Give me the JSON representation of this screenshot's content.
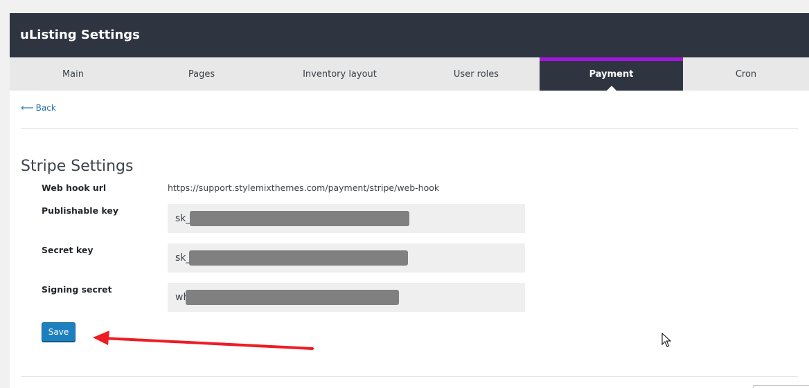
{
  "app": {
    "title": "uListing Settings"
  },
  "tabs": [
    {
      "label": "Main"
    },
    {
      "label": "Pages"
    },
    {
      "label": "Inventory layout"
    },
    {
      "label": "User roles"
    },
    {
      "label": "Payment",
      "active": true
    },
    {
      "label": "Cron"
    }
  ],
  "nav": {
    "back_label": "Back",
    "back_icon": "arrow-left-icon"
  },
  "section": {
    "title": "Stripe Settings"
  },
  "fields": {
    "webhook": {
      "label": "Web hook url",
      "value": "https://support.stylemixthemes.com/payment/stripe/web-hook"
    },
    "publishable": {
      "label": "Publishable key",
      "value": "sk_"
    },
    "secret": {
      "label": "Secret key",
      "value": "sk_"
    },
    "signing": {
      "label": "Signing secret",
      "value": "wh"
    }
  },
  "actions": {
    "save_label": "Save"
  },
  "colors": {
    "header_bg": "#2f3441",
    "active_tab_accent": "#a316e0",
    "primary_button": "#1c80c0",
    "link": "#2271b1",
    "annotation_arrow": "#ee1c24"
  }
}
